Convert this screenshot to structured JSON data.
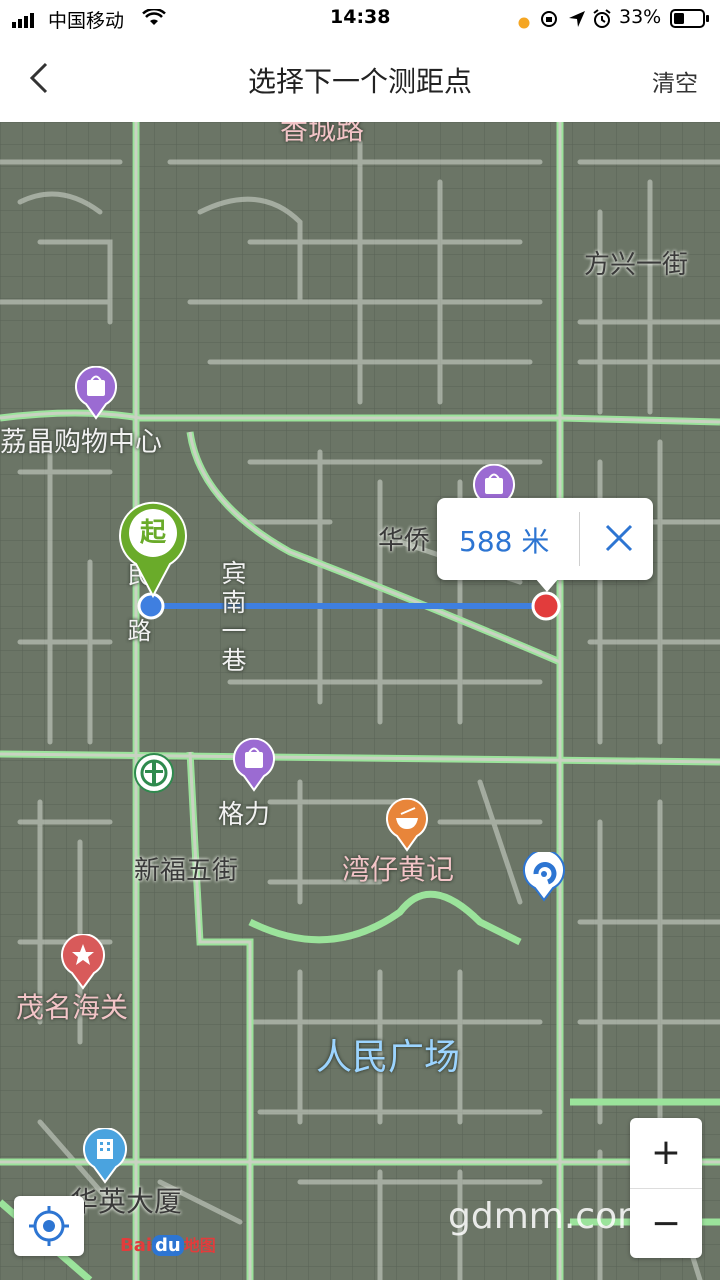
{
  "status_bar": {
    "carrier": "中国移动",
    "time": "14:38",
    "battery": "33%"
  },
  "nav": {
    "title": "选择下一个测距点",
    "clear_label": "清空"
  },
  "map": {
    "labels": {
      "top_road": "香城路",
      "fangxing": "方兴一街",
      "lijing": "荔晶购物中心",
      "huaqiao": "华侨",
      "binnan": "宾南一巷",
      "road_side": "路",
      "road_top": "民",
      "geli": "格力",
      "xinfu": "新福五街",
      "wanzai": "湾仔黄记",
      "maoming": "茂名海关",
      "renmin": "人民广场",
      "building": "华英大厦"
    },
    "start_marker": "起",
    "distance": "588 米"
  },
  "zoom": {
    "in": "+",
    "out": "−"
  },
  "logo": {
    "bai": "Bai",
    "du": "du",
    "suffix": "地图"
  },
  "watermark": "gdmm.com",
  "colors": {
    "road": "#9be39b",
    "measure_line": "#3f7fe0",
    "start_pin": "#6aab2a",
    "end_point": "#e23c3c",
    "accent_blue": "#2d75d2",
    "poi_purple": "#9b6bd2",
    "poi_orange": "#e8853a",
    "poi_red": "#d85a5a"
  }
}
